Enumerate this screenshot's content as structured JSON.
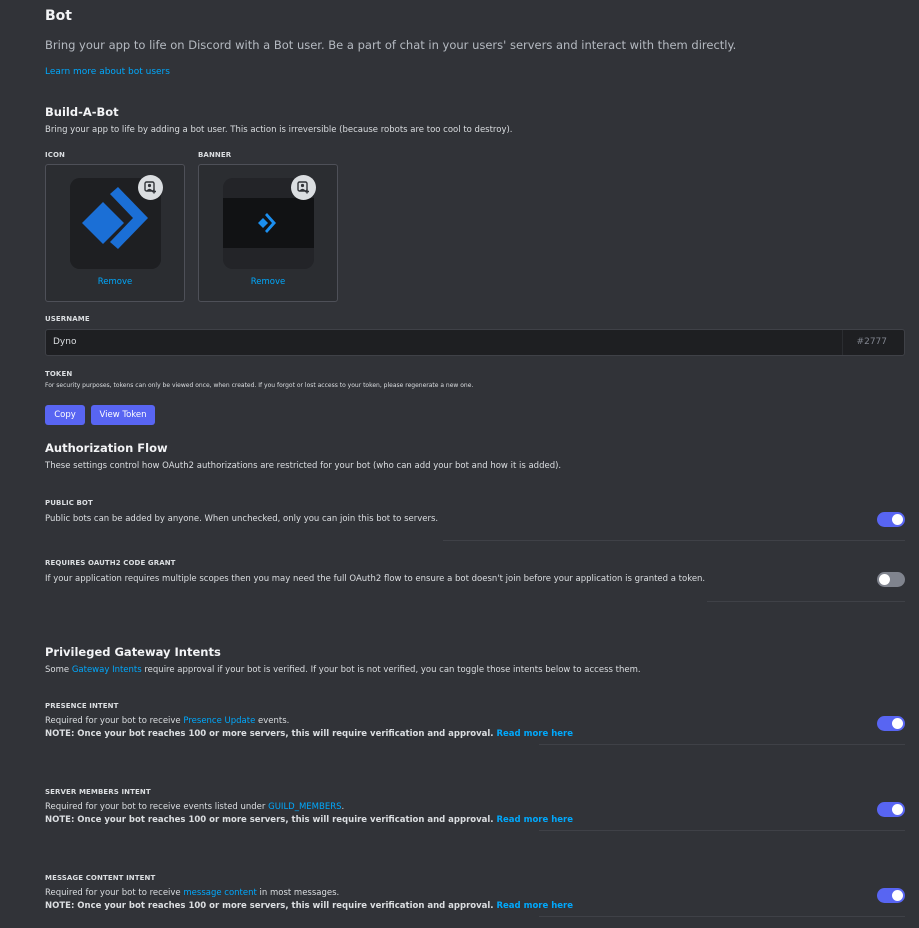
{
  "page": {
    "title": "Bot",
    "lead": "Bring your app to life on Discord with a Bot user. Be a part of chat in your users' servers and interact with them directly.",
    "learn_more": "Learn more about bot users"
  },
  "build_a_bot": {
    "title": "Build-A-Bot",
    "description": "Bring your app to life by adding a bot user. This action is irreversible (because robots are too cool to destroy).",
    "icon_label": "ICON",
    "banner_label": "BANNER",
    "remove_label": "Remove",
    "username_label": "USERNAME",
    "username_value": "Dyno",
    "discriminator": "#2777",
    "token_label": "TOKEN",
    "token_note": "For security purposes, tokens can only be viewed once, when created. If you forgot or lost access to your token, please regenerate a new one.",
    "copy_button": "Copy",
    "view_token_button": "View Token"
  },
  "authorization_flow": {
    "title": "Authorization Flow",
    "description": "These settings control how OAuth2 authorizations are restricted for your bot (who can add your bot and how it is added).",
    "public_bot": {
      "label": "PUBLIC BOT",
      "description": "Public bots can be added by anyone. When unchecked, only you can join this bot to servers.",
      "enabled": true
    },
    "requires_code_grant": {
      "label": "REQUIRES OAUTH2 CODE GRANT",
      "description": "If your application requires multiple scopes then you may need the full OAuth2 flow to ensure a bot doesn't join before your application is granted a token.",
      "enabled": false
    }
  },
  "privileged_intents": {
    "title": "Privileged Gateway Intents",
    "desc_before": "Some ",
    "desc_link": "Gateway Intents",
    "desc_after": " require approval if your bot is verified. If your bot is not verified, you can toggle those intents below to access them.",
    "note": "NOTE: Once your bot reaches 100 or more servers, this will require verification and approval.",
    "read_more": "Read more here",
    "presence": {
      "label": "PRESENCE INTENT",
      "before": "Required for your bot to receive ",
      "link": "Presence Update",
      "after": " events.",
      "enabled": true
    },
    "server_members": {
      "label": "SERVER MEMBERS INTENT",
      "before": "Required for your bot to receive events listed under ",
      "link": "GUILD_MEMBERS",
      "after": ".",
      "enabled": true
    },
    "message_content": {
      "label": "MESSAGE CONTENT INTENT",
      "before": "Required for your bot to receive ",
      "link": "message content",
      "after": " in most messages.",
      "enabled": true
    }
  },
  "colors": {
    "background": "#313338",
    "accent": "#5865f2",
    "link": "#00a8fc",
    "bot_logo": "#1b6fd6"
  },
  "icons": {
    "edit_image": "image-edit-icon",
    "bot_logo": "dyno-logo-icon"
  }
}
